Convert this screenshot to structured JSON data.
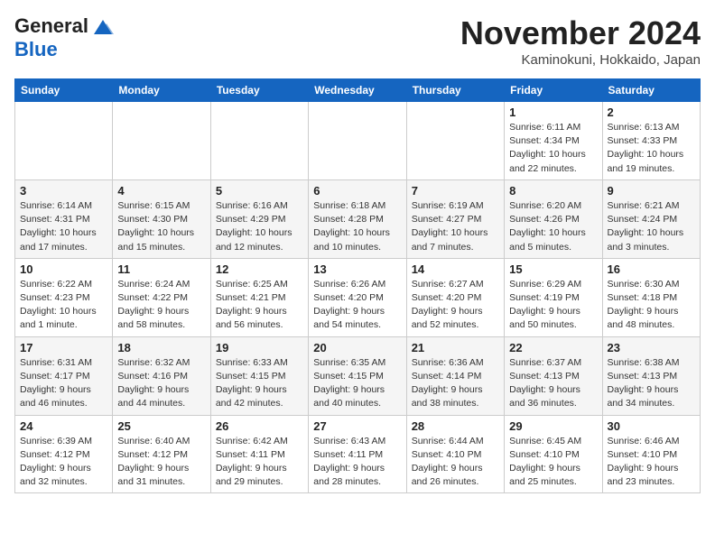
{
  "header": {
    "logo_general": "General",
    "logo_blue": "Blue",
    "month_title": "November 2024",
    "location": "Kaminokuni, Hokkaido, Japan"
  },
  "weekdays": [
    "Sunday",
    "Monday",
    "Tuesday",
    "Wednesday",
    "Thursday",
    "Friday",
    "Saturday"
  ],
  "weeks": [
    [
      {
        "day": "",
        "info": ""
      },
      {
        "day": "",
        "info": ""
      },
      {
        "day": "",
        "info": ""
      },
      {
        "day": "",
        "info": ""
      },
      {
        "day": "",
        "info": ""
      },
      {
        "day": "1",
        "info": "Sunrise: 6:11 AM\nSunset: 4:34 PM\nDaylight: 10 hours and 22 minutes."
      },
      {
        "day": "2",
        "info": "Sunrise: 6:13 AM\nSunset: 4:33 PM\nDaylight: 10 hours and 19 minutes."
      }
    ],
    [
      {
        "day": "3",
        "info": "Sunrise: 6:14 AM\nSunset: 4:31 PM\nDaylight: 10 hours and 17 minutes."
      },
      {
        "day": "4",
        "info": "Sunrise: 6:15 AM\nSunset: 4:30 PM\nDaylight: 10 hours and 15 minutes."
      },
      {
        "day": "5",
        "info": "Sunrise: 6:16 AM\nSunset: 4:29 PM\nDaylight: 10 hours and 12 minutes."
      },
      {
        "day": "6",
        "info": "Sunrise: 6:18 AM\nSunset: 4:28 PM\nDaylight: 10 hours and 10 minutes."
      },
      {
        "day": "7",
        "info": "Sunrise: 6:19 AM\nSunset: 4:27 PM\nDaylight: 10 hours and 7 minutes."
      },
      {
        "day": "8",
        "info": "Sunrise: 6:20 AM\nSunset: 4:26 PM\nDaylight: 10 hours and 5 minutes."
      },
      {
        "day": "9",
        "info": "Sunrise: 6:21 AM\nSunset: 4:24 PM\nDaylight: 10 hours and 3 minutes."
      }
    ],
    [
      {
        "day": "10",
        "info": "Sunrise: 6:22 AM\nSunset: 4:23 PM\nDaylight: 10 hours and 1 minute."
      },
      {
        "day": "11",
        "info": "Sunrise: 6:24 AM\nSunset: 4:22 PM\nDaylight: 9 hours and 58 minutes."
      },
      {
        "day": "12",
        "info": "Sunrise: 6:25 AM\nSunset: 4:21 PM\nDaylight: 9 hours and 56 minutes."
      },
      {
        "day": "13",
        "info": "Sunrise: 6:26 AM\nSunset: 4:20 PM\nDaylight: 9 hours and 54 minutes."
      },
      {
        "day": "14",
        "info": "Sunrise: 6:27 AM\nSunset: 4:20 PM\nDaylight: 9 hours and 52 minutes."
      },
      {
        "day": "15",
        "info": "Sunrise: 6:29 AM\nSunset: 4:19 PM\nDaylight: 9 hours and 50 minutes."
      },
      {
        "day": "16",
        "info": "Sunrise: 6:30 AM\nSunset: 4:18 PM\nDaylight: 9 hours and 48 minutes."
      }
    ],
    [
      {
        "day": "17",
        "info": "Sunrise: 6:31 AM\nSunset: 4:17 PM\nDaylight: 9 hours and 46 minutes."
      },
      {
        "day": "18",
        "info": "Sunrise: 6:32 AM\nSunset: 4:16 PM\nDaylight: 9 hours and 44 minutes."
      },
      {
        "day": "19",
        "info": "Sunrise: 6:33 AM\nSunset: 4:15 PM\nDaylight: 9 hours and 42 minutes."
      },
      {
        "day": "20",
        "info": "Sunrise: 6:35 AM\nSunset: 4:15 PM\nDaylight: 9 hours and 40 minutes."
      },
      {
        "day": "21",
        "info": "Sunrise: 6:36 AM\nSunset: 4:14 PM\nDaylight: 9 hours and 38 minutes."
      },
      {
        "day": "22",
        "info": "Sunrise: 6:37 AM\nSunset: 4:13 PM\nDaylight: 9 hours and 36 minutes."
      },
      {
        "day": "23",
        "info": "Sunrise: 6:38 AM\nSunset: 4:13 PM\nDaylight: 9 hours and 34 minutes."
      }
    ],
    [
      {
        "day": "24",
        "info": "Sunrise: 6:39 AM\nSunset: 4:12 PM\nDaylight: 9 hours and 32 minutes."
      },
      {
        "day": "25",
        "info": "Sunrise: 6:40 AM\nSunset: 4:12 PM\nDaylight: 9 hours and 31 minutes."
      },
      {
        "day": "26",
        "info": "Sunrise: 6:42 AM\nSunset: 4:11 PM\nDaylight: 9 hours and 29 minutes."
      },
      {
        "day": "27",
        "info": "Sunrise: 6:43 AM\nSunset: 4:11 PM\nDaylight: 9 hours and 28 minutes."
      },
      {
        "day": "28",
        "info": "Sunrise: 6:44 AM\nSunset: 4:10 PM\nDaylight: 9 hours and 26 minutes."
      },
      {
        "day": "29",
        "info": "Sunrise: 6:45 AM\nSunset: 4:10 PM\nDaylight: 9 hours and 25 minutes."
      },
      {
        "day": "30",
        "info": "Sunrise: 6:46 AM\nSunset: 4:10 PM\nDaylight: 9 hours and 23 minutes."
      }
    ]
  ]
}
